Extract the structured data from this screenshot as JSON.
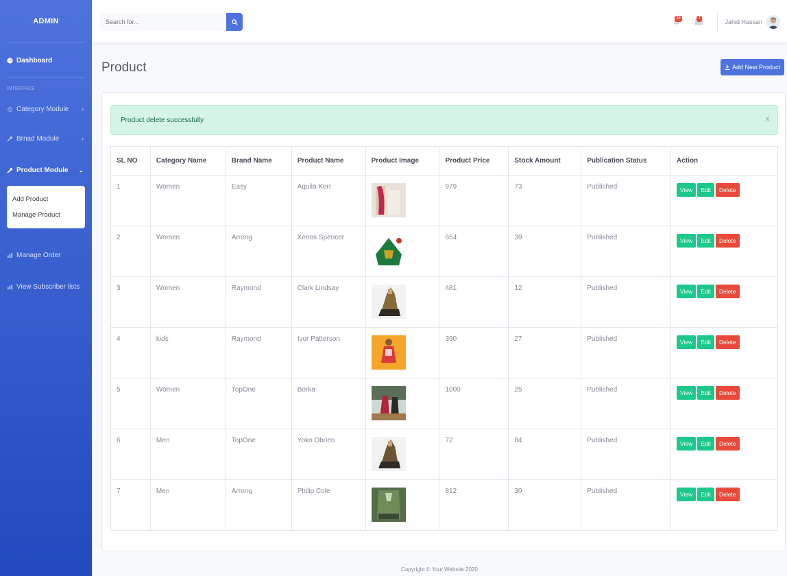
{
  "sidebar": {
    "brand": "ADMIN",
    "dashboard": "Dashboard",
    "heading": "INTERFACE",
    "category_module": "Category Module",
    "brand_module": "Brnad Module",
    "product_module": "Product Module",
    "submenu": [
      "Add Product",
      "Manage Product"
    ],
    "manage_order": "Manage Order",
    "subscriber_lists": "View Subscriber lists"
  },
  "topbar": {
    "search_placeholder": "Search for...",
    "alerts_badge": "3+",
    "messages_badge": "7",
    "user_name": "Jahid Hassan"
  },
  "page": {
    "title": "Product",
    "add_button": "Add New Product"
  },
  "alert": {
    "message": "Product delete successfully",
    "close": "x"
  },
  "table": {
    "headers": [
      "SL NO",
      "Category Name",
      "Brand Name",
      "Product Name",
      "Product Image",
      "Product Price",
      "Stock Amount",
      "Publication Status",
      "Action"
    ],
    "rows": [
      {
        "sl": "1",
        "category": "Women",
        "brand": "Easy",
        "product": "Aquila Kerr",
        "price": "979",
        "stock": "73",
        "status": "Published"
      },
      {
        "sl": "2",
        "category": "Women",
        "brand": "Arrong",
        "product": "Xenos Spencer",
        "price": "654",
        "stock": "39",
        "status": "Published"
      },
      {
        "sl": "3",
        "category": "Women",
        "brand": "Raymond",
        "product": "Clark Lindsay",
        "price": "481",
        "stock": "12",
        "status": "Published"
      },
      {
        "sl": "4",
        "category": "kids",
        "brand": "Raymond",
        "product": "Ivor Patterson",
        "price": "390",
        "stock": "27",
        "status": "Published"
      },
      {
        "sl": "5",
        "category": "Women",
        "brand": "TopOne",
        "product": "Borka",
        "price": "1000",
        "stock": "25",
        "status": "Published"
      },
      {
        "sl": "6",
        "category": "Men",
        "brand": "TopOne",
        "product": "Yoko Obrien",
        "price": "72",
        "stock": "84",
        "status": "Published"
      },
      {
        "sl": "7",
        "category": "Men",
        "brand": "Arrong",
        "product": "Philip Cole",
        "price": "812",
        "stock": "30",
        "status": "Published"
      }
    ],
    "actions": {
      "view": "View",
      "edit": "Edit",
      "delete": "Delete"
    }
  },
  "footer": {
    "copyright": "Copyright © Your Website 2020"
  },
  "colors": {
    "primary": "#4e73df",
    "success": "#1cc88a",
    "danger": "#e74a3b",
    "alert_bg": "#d4f4e6"
  }
}
